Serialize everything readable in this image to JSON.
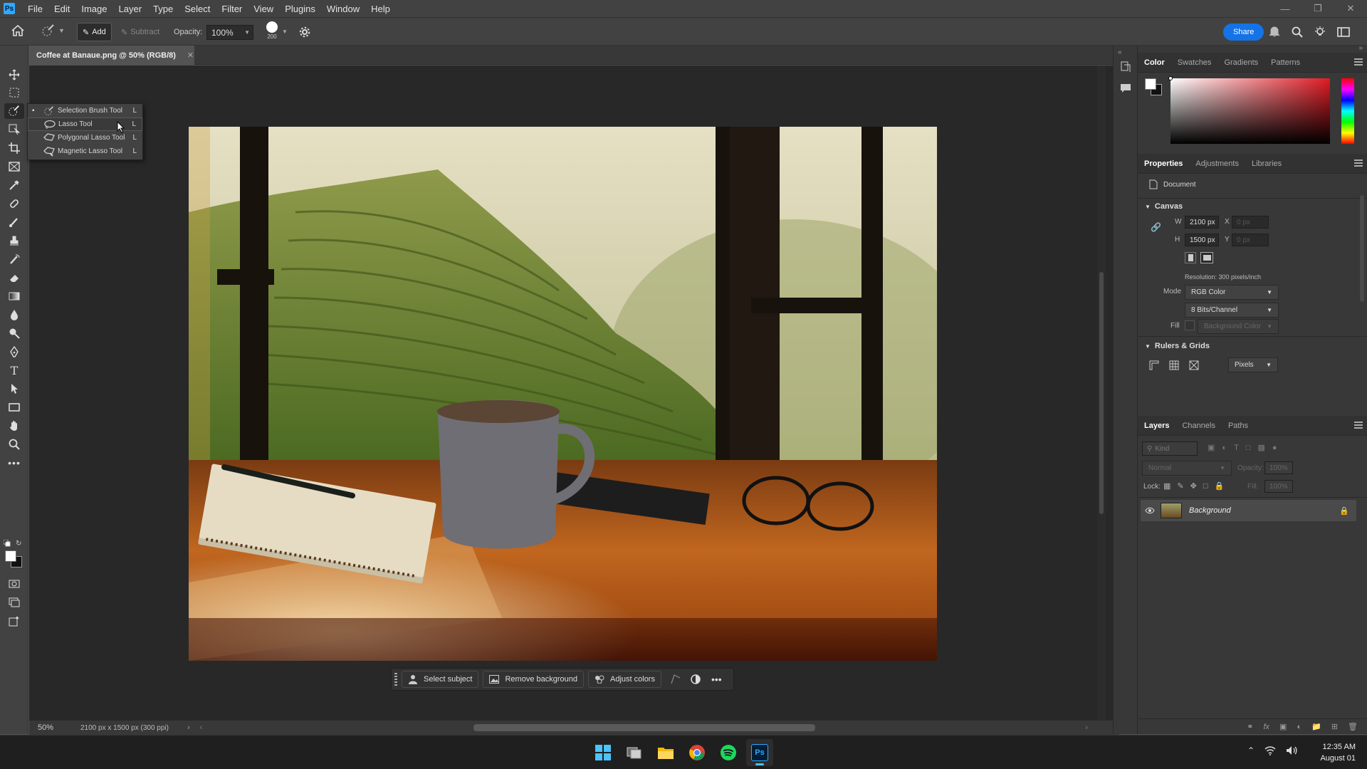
{
  "app": {
    "logo": "Ps"
  },
  "menu": [
    "File",
    "Edit",
    "Image",
    "Layer",
    "Type",
    "Select",
    "Filter",
    "View",
    "Plugins",
    "Window",
    "Help"
  ],
  "options": {
    "add_label": "Add",
    "subtract_label": "Subtract",
    "opacity_label": "Opacity:",
    "opacity_value": "100%",
    "brush_size": "200",
    "share_label": "Share"
  },
  "document": {
    "tab_title": "Coffee at Banaue.png @ 50% (RGB/8)",
    "zoom": "50%",
    "info": "2100 px x 1500 px (300 ppi)"
  },
  "flyout": {
    "items": [
      {
        "label": "Selection Brush Tool",
        "shortcut": "L",
        "icon": "selection-brush-icon"
      },
      {
        "label": "Lasso Tool",
        "shortcut": "L",
        "icon": "lasso-icon"
      },
      {
        "label": "Polygonal Lasso Tool",
        "shortcut": "L",
        "icon": "polygonal-lasso-icon"
      },
      {
        "label": "Magnetic Lasso Tool",
        "shortcut": "L",
        "icon": "magnetic-lasso-icon"
      }
    ]
  },
  "contextbar": {
    "select_subject": "Select subject",
    "remove_background": "Remove background",
    "adjust_colors": "Adjust colors"
  },
  "color_panel": {
    "tabs": [
      "Color",
      "Swatches",
      "Gradients",
      "Patterns"
    ]
  },
  "properties_panel": {
    "tabs": [
      "Properties",
      "Adjustments",
      "Libraries"
    ],
    "document_label": "Document",
    "canvas_label": "Canvas",
    "w_label": "W",
    "w_value": "2100 px",
    "h_label": "H",
    "h_value": "1500 px",
    "x_label": "X",
    "x_value": "0 px",
    "y_label": "Y",
    "y_value": "0 px",
    "resolution": "Resolution: 300 pixels/inch",
    "mode_label": "Mode",
    "mode_value": "RGB Color",
    "depth_value": "8 Bits/Channel",
    "fill_label": "Fill",
    "fill_value": "Background Color",
    "rulers_label": "Rulers & Grids",
    "units_value": "Pixels"
  },
  "layers_panel": {
    "tabs": [
      "Layers",
      "Channels",
      "Paths"
    ],
    "kind_placeholder": "Kind",
    "blend_mode": "Normal",
    "opacity_label": "Opacity:",
    "opacity_value": "100%",
    "lock_label": "Lock:",
    "fill_label": "Fill:",
    "fill_value": "100%",
    "layers": [
      {
        "name": "Background",
        "visible": true,
        "locked": true
      }
    ]
  },
  "taskbar": {
    "time": "12:35 AM",
    "date": "August 01"
  },
  "colors": {
    "accent": "#1473e6",
    "ps_blue": "#31a8ff",
    "panel_bg": "#383838"
  }
}
